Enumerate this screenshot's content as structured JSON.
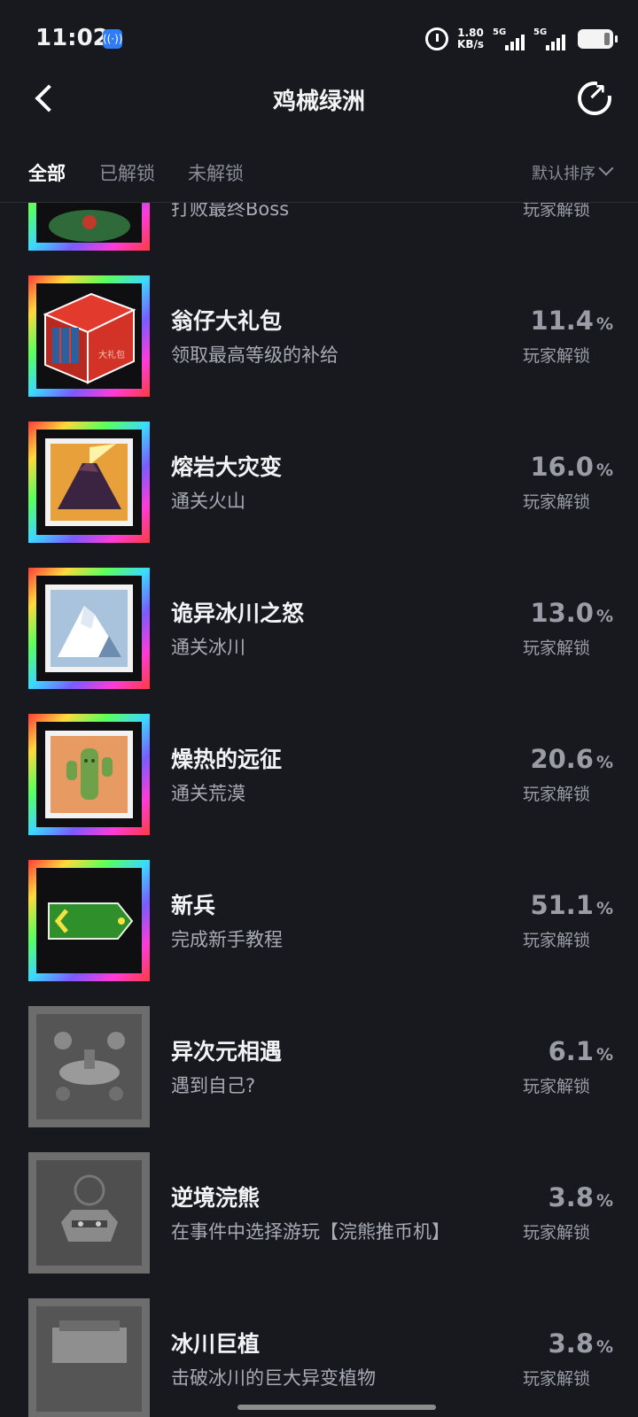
{
  "status": {
    "time": "11:02",
    "speed_top": "1.80",
    "speed_bottom": "KB/s",
    "sim1": "5G",
    "sim2": "5G"
  },
  "header": {
    "title": "鸡械绿洲"
  },
  "tabs": [
    {
      "label": "全部"
    },
    {
      "label": "已解锁"
    },
    {
      "label": "未解锁"
    }
  ],
  "sort": {
    "label": "默认排序"
  },
  "achievements": [
    {
      "name": "",
      "desc": "打败最终Boss",
      "pct": "",
      "unlock": "玩家解锁"
    },
    {
      "name": "翁仔大礼包",
      "desc": "领取最高等级的补给",
      "pct": "11.4",
      "unlock": "玩家解锁"
    },
    {
      "name": "熔岩大灾变",
      "desc": "通关火山",
      "pct": "16.0",
      "unlock": "玩家解锁"
    },
    {
      "name": "诡异冰川之怒",
      "desc": "通关冰川",
      "pct": "13.0",
      "unlock": "玩家解锁"
    },
    {
      "name": "燥热的远征",
      "desc": "通关荒漠",
      "pct": "20.6",
      "unlock": "玩家解锁"
    },
    {
      "name": "新兵",
      "desc": "完成新手教程",
      "pct": "51.1",
      "unlock": "玩家解锁"
    },
    {
      "name": "异次元相遇",
      "desc": "遇到自己?",
      "pct": "6.1",
      "unlock": "玩家解锁"
    },
    {
      "name": "逆境浣熊",
      "desc": "在事件中选择游玩【浣熊推币机】",
      "pct": "3.8",
      "unlock": "玩家解锁"
    },
    {
      "name": "冰川巨植",
      "desc": "击破冰川的巨大异变植物",
      "pct": "3.8",
      "unlock": "玩家解锁"
    }
  ],
  "pct_unit": "%",
  "box_label": "大礼包"
}
